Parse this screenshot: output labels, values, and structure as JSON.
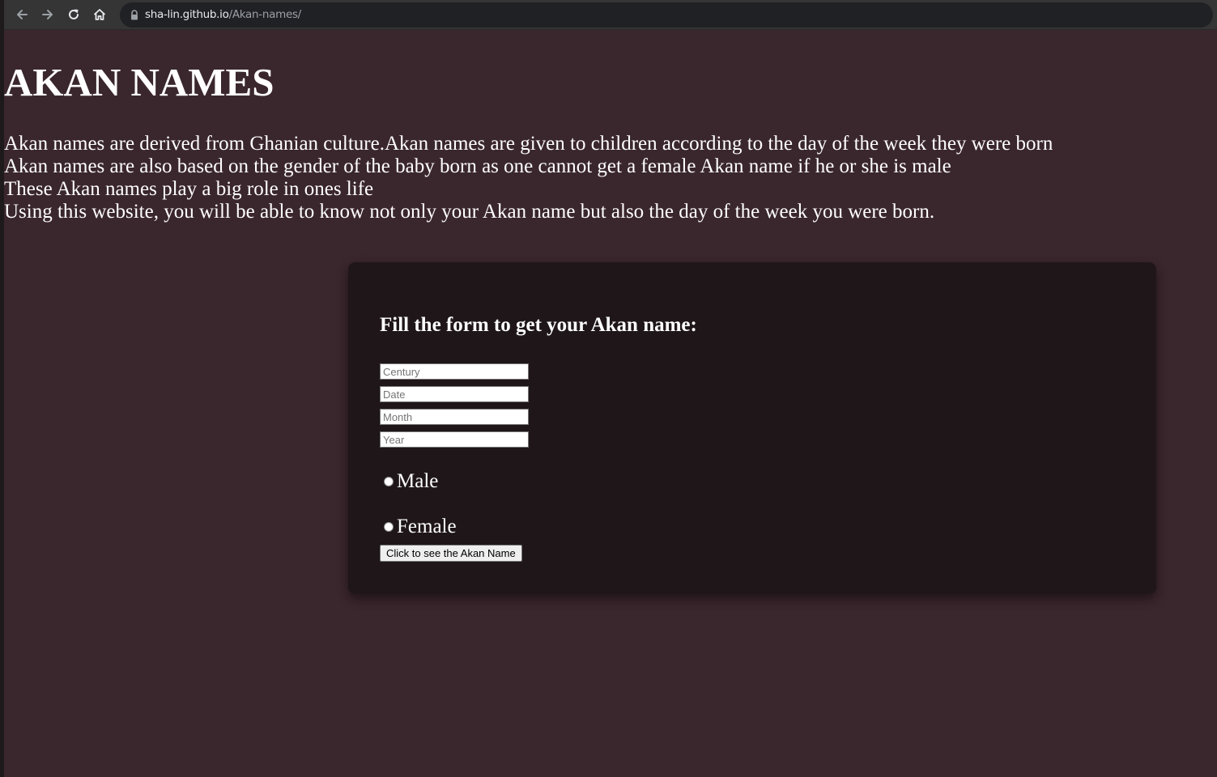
{
  "browser": {
    "url_host": "sha-lin.github.io",
    "url_path": "/Akan-names/",
    "icons": {
      "back": "arrow-left",
      "forward": "arrow-right",
      "reload": "reload",
      "home": "home",
      "security": "lock"
    }
  },
  "page": {
    "title": "AKAN NAMES",
    "intro_lines": [
      "Akan names are derived from Ghanian culture.Akan names are given to children according to the day of the week they were born",
      "Akan names are also based on the gender of the baby born as one cannot get a female Akan name if he or she is male",
      "These Akan names play a big role in ones life",
      "Using this website, you will be able to know not only your Akan name but also the day of the week you were born."
    ]
  },
  "form": {
    "heading": "Fill the form to get your Akan name:",
    "fields": {
      "century": {
        "placeholder": "Century",
        "value": ""
      },
      "date": {
        "placeholder": "Date",
        "value": ""
      },
      "month": {
        "placeholder": "Month",
        "value": ""
      },
      "year": {
        "placeholder": "Year",
        "value": ""
      }
    },
    "gender_options": [
      "Male",
      "Female"
    ],
    "submit_label": "Click to see the Akan Name"
  },
  "colors": {
    "page_background": "#3a262d",
    "card_background": "#1e1619",
    "toolbar_background": "#353535",
    "text": "#ffffff"
  }
}
